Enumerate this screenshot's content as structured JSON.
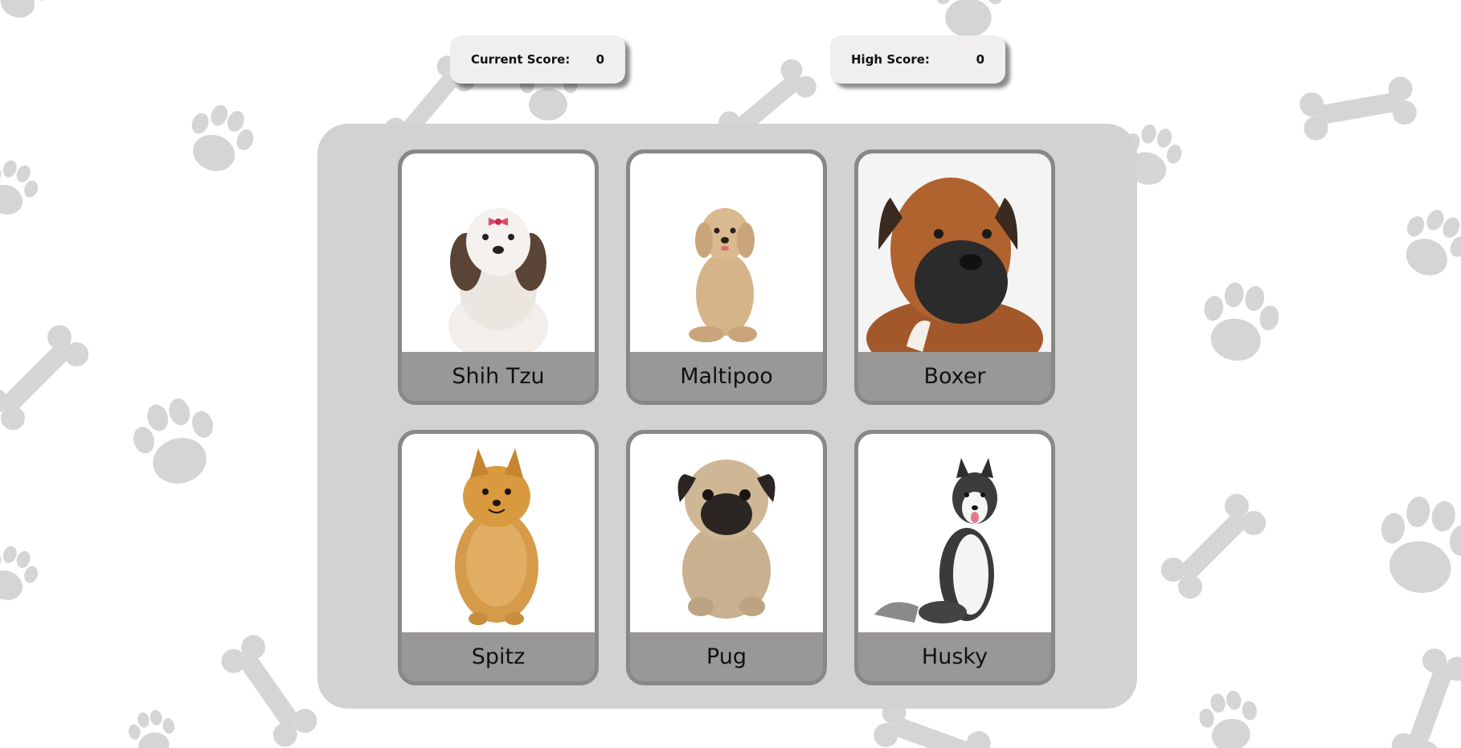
{
  "scoreboard": {
    "current_label": "Current Score:",
    "current_value": "0",
    "high_label": "High Score:",
    "high_value": "0"
  },
  "cards": [
    {
      "label": "Shih Tzu",
      "icon": "shih-tzu-photo"
    },
    {
      "label": "Maltipoo",
      "icon": "maltipoo-photo"
    },
    {
      "label": "Boxer",
      "icon": "boxer-photo"
    },
    {
      "label": "Spitz",
      "icon": "spitz-photo"
    },
    {
      "label": "Pug",
      "icon": "pug-photo"
    },
    {
      "label": "Husky",
      "icon": "husky-photo"
    }
  ],
  "colors": {
    "background": "#ffffff",
    "pattern": "#d5d5d5",
    "board": "#d2d2d2",
    "card": "#9a9797",
    "score_box": "#f1eeee"
  }
}
